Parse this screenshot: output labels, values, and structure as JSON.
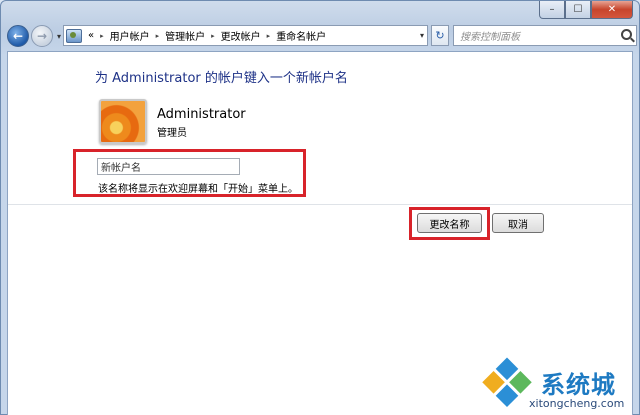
{
  "window": {
    "caption_minimize": "–",
    "caption_maximize": "☐",
    "caption_close": "✕"
  },
  "nav": {
    "back_icon": "back-arrow-icon",
    "forward_icon": "forward-arrow-icon",
    "back_glyph": "←",
    "forward_glyph": "→",
    "dropdown_glyph": "▾"
  },
  "address": {
    "overflow": "«",
    "crumbs": [
      "用户帐户",
      "管理帐户",
      "更改帐户",
      "重命名帐户"
    ],
    "separator": "▸",
    "dropdown_glyph": "▾"
  },
  "refresh_glyph": "↻",
  "search": {
    "placeholder": "搜索控制面板"
  },
  "main": {
    "heading": "为 Administrator 的帐户键入一个新帐户名",
    "account_name": "Administrator",
    "account_role": "管理员",
    "new_name_value": "新帐户名",
    "hint": "该名称将显示在欢迎屏幕和「开始」菜单上。",
    "rename_button": "更改名称",
    "cancel_button": "取消"
  },
  "watermark": {
    "title": "系统城",
    "subtitle": "xitongcheng.com"
  },
  "colors": {
    "heading": "#1e3287",
    "highlight_red": "#d8232a",
    "watermark_blue": "#1e7ac2"
  }
}
